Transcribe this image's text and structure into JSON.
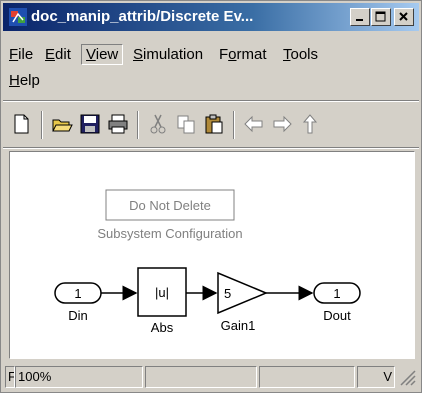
{
  "window": {
    "title": "doc_manip_attrib/Discrete Ev...",
    "controls": {
      "minimize": "_",
      "maximize": "□",
      "close": "×"
    }
  },
  "menu": {
    "items": [
      {
        "label": "File",
        "mnemonic": "F"
      },
      {
        "label": "Edit",
        "mnemonic": "E"
      },
      {
        "label": "View",
        "mnemonic": "V"
      },
      {
        "label": "Simulation",
        "mnemonic": "S"
      },
      {
        "label": "Format",
        "mnemonic": "o"
      },
      {
        "label": "Tools",
        "mnemonic": "T"
      },
      {
        "label": "Help",
        "mnemonic": "H"
      }
    ],
    "active": "View"
  },
  "toolbar": {
    "icons": [
      "new-document-icon",
      "open-folder-icon",
      "save-icon",
      "print-icon",
      "cut-icon",
      "copy-icon",
      "paste-icon",
      "back-arrow-icon",
      "forward-arrow-icon",
      "up-level-icon"
    ]
  },
  "diagram": {
    "annotation_box": "Do Not Delete",
    "annotation_text": "Subsystem Configuration",
    "blocks": {
      "din": {
        "port": "1",
        "name": "Din"
      },
      "abs": {
        "symbol": "|u|",
        "name": "Abs"
      },
      "gain": {
        "value": "5",
        "name": "Gain1"
      },
      "dout": {
        "port": "1",
        "name": "Dout"
      }
    }
  },
  "status": {
    "left": "F",
    "zoom": "100%",
    "right": "V"
  },
  "colors": {
    "title_start": "#0a246a",
    "title_end": "#a6caf0",
    "chrome": "#d4d0c8",
    "annotation_gray": "#808080"
  }
}
